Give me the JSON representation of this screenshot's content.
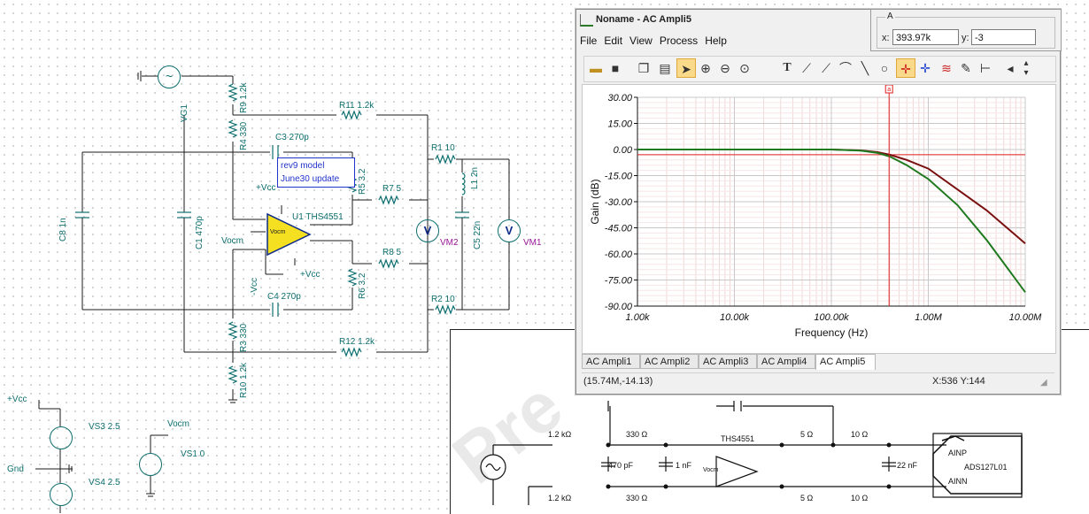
{
  "schematic": {
    "labels": {
      "r9": "R9 1.2k",
      "r4": "R4 330",
      "r11": "R11 1.2k",
      "c3": "C3 270p",
      "r1": "R1 10",
      "l1": "L1 2n",
      "r5": "R5 3.2",
      "r7": "R7 5",
      "vcc_top": "+Vcc",
      "u1": "U1 THS4551",
      "vocm": "Vocm",
      "vocm_inner": "Vocm",
      "c8": "C8 1n",
      "c1": "C1 470p",
      "vm2": "VM2",
      "c5": "C5 22n",
      "vm1": "VM1",
      "r8": "R8 5",
      "vcc_mid": "+Vcc",
      "r6": "R6 3.2",
      "neg_vcc": "-Vcc",
      "c4": "C4 270p",
      "r2": "R2 10",
      "r3": "R3 330",
      "r12": "R12 1.2k",
      "r10": "R10 1.2k",
      "vg1": "VG1",
      "vcc_src": "+Vcc",
      "vs3": "VS3 2.5",
      "gnd": "Gnd",
      "vs4": "VS4 2.5",
      "vocm_src": "Vocm",
      "vs1": "VS1 0"
    },
    "note_lines": [
      "rev9 model",
      "June30 update"
    ]
  },
  "datasheet": {
    "labels": {
      "r_top_in": "1.2 kΩ",
      "r_top_330": "330 Ω",
      "amp": "THS4551",
      "r_top_5": "5 Ω",
      "r_top_10": "10 Ω",
      "c470": "470 pF",
      "c1n": "1 nF",
      "vocm": "Vocm",
      "c22n": "22 nF",
      "ainp": "AINP",
      "adc": "ADS127L01",
      "ainn": "AINN",
      "r_bot_in": "1.2 kΩ",
      "r_bot_330": "330 Ω",
      "r_bot_5": "5 Ω",
      "r_bot_10": "10 Ω"
    }
  },
  "window": {
    "title": "Noname - AC Ampli5",
    "menu": [
      "File",
      "Edit",
      "View",
      "Process",
      "Help"
    ],
    "toolbar_icons": [
      "open-folder-icon",
      "save-icon",
      "copy-icon",
      "paste-icon",
      "select-arrow-icon",
      "zoom-in-icon",
      "zoom-out-icon",
      "zoom-100-icon",
      "text-tool-icon",
      "marker-icon",
      "cursor-a-icon",
      "axis-icon",
      "line-tool-icon",
      "circle-tool-icon",
      "cursor-cross-icon",
      "cursor-b-icon",
      "curves-icon",
      "probe-icon",
      "flag-icon",
      "scroll-left-icon",
      "scroll-updown-icon"
    ],
    "tabs": [
      "AC Ampli1",
      "AC Ampli2",
      "AC Ampli3",
      "AC Ampli4",
      "AC Ampli5"
    ],
    "selected_tab": 4,
    "status_left": "(15.74M,-14.13)",
    "status_right": "X:536  Y:144",
    "cursor_marker": "a"
  },
  "cursor_readout": {
    "group_label": "A",
    "x_label": "x:",
    "x_value": "393.97k",
    "y_label": "y:",
    "y_value": "-3"
  },
  "colors": {
    "wire": "#1a1a1a",
    "component": "#0d6e6e",
    "meter": "#9a1a9a",
    "grid_major": "#c8c8c8",
    "grid_minor": "#f0d8d8",
    "series_red": "#7a1010",
    "series_green": "#1f7a1f",
    "cursor": "#e02020"
  },
  "chart_data": {
    "type": "line",
    "title": "",
    "xlabel": "Frequency (Hz)",
    "ylabel": "Gain (dB)",
    "xscale": "log",
    "xlim": [
      1000,
      10000000
    ],
    "ylim": [
      -90,
      30
    ],
    "x_ticks": [
      "1.00k",
      "10.00k",
      "100.00k",
      "1.00M",
      "10.00M"
    ],
    "y_ticks": [
      "30.00",
      "15.00",
      "0.00",
      "-15.00",
      "-30.00",
      "-45.00",
      "-60.00",
      "-75.00",
      "-90.00"
    ],
    "grid": true,
    "cursor_x": 393970,
    "reference_y": -3,
    "series": [
      {
        "color": "#7a1010",
        "x": [
          1000,
          10000,
          100000,
          200000,
          300000,
          400000,
          600000,
          1000000,
          2000000,
          4000000,
          10000000
        ],
        "y": [
          0,
          0,
          0,
          -0.5,
          -1.5,
          -3,
          -6,
          -11,
          -23,
          -35,
          -54
        ]
      },
      {
        "color": "#1f7a1f",
        "x": [
          1000,
          10000,
          100000,
          200000,
          300000,
          400000,
          600000,
          1000000,
          2000000,
          4000000,
          10000000
        ],
        "y": [
          0,
          0,
          0,
          -0.6,
          -2,
          -4,
          -9,
          -17,
          -32,
          -52,
          -82
        ]
      }
    ]
  }
}
